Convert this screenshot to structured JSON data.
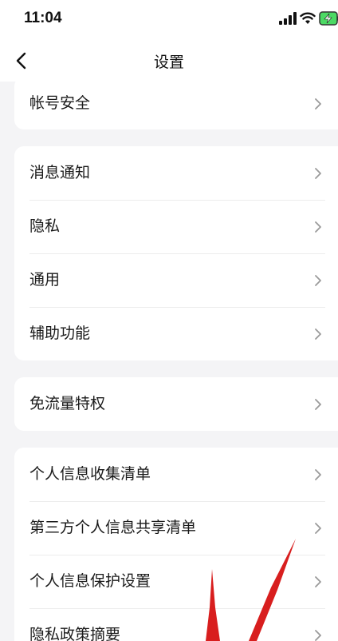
{
  "status_bar": {
    "time": "11:04",
    "icons": [
      "signal-icon",
      "wifi-icon",
      "battery-charging-icon"
    ],
    "battery_color": "#4cd964"
  },
  "nav": {
    "title": "设置",
    "back_icon": "chevron-left-icon"
  },
  "groups": [
    {
      "items": [
        {
          "label": "帐号安全"
        }
      ]
    },
    {
      "items": [
        {
          "label": "消息通知"
        },
        {
          "label": "隐私"
        },
        {
          "label": "通用"
        },
        {
          "label": "辅助功能"
        }
      ]
    },
    {
      "items": [
        {
          "label": "免流量特权"
        }
      ]
    },
    {
      "items": [
        {
          "label": "个人信息收集清单"
        },
        {
          "label": "第三方个人信息共享清单"
        },
        {
          "label": "个人信息保护设置"
        },
        {
          "label": "隐私政策摘要"
        }
      ]
    }
  ],
  "colors": {
    "background": "#f4f4f6",
    "card": "#ffffff",
    "annotation_arrow": "#d81e1e"
  }
}
